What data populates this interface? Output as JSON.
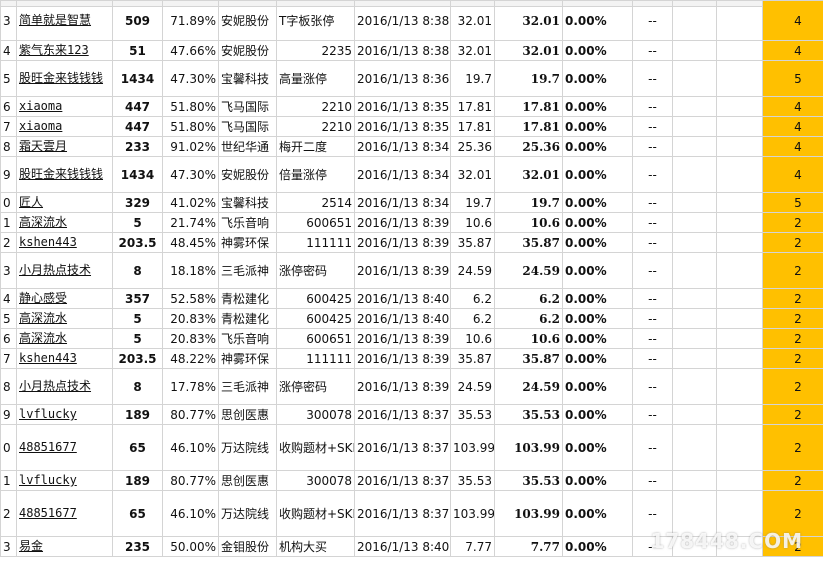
{
  "rows": [
    {
      "rn": "3",
      "user": "简单就是智慧",
      "cnt": "509",
      "pct": "71.89%",
      "stock": "安妮股份",
      "code": "T字板张停",
      "time": "2016/1/13 8:38",
      "p1": "32.01",
      "p2": "32.01",
      "chg": "0.00%",
      "dash": "--",
      "lvl": "4"
    },
    {
      "rn": "4",
      "user": "紫气东来123",
      "cnt": "51",
      "pct": "47.66%",
      "stock": "安妮股份",
      "code": "2235",
      "time": "2016/1/13 8:38",
      "p1": "32.01",
      "p2": "32.01",
      "chg": "0.00%",
      "dash": "--",
      "lvl": "4"
    },
    {
      "rn": "5",
      "user": "股旺金来钱钱钱",
      "cnt": "1434",
      "pct": "47.30%",
      "stock": "宝馨科技",
      "code": "高量涨停",
      "time": "2016/1/13 8:36",
      "p1": "19.7",
      "p2": "19.7",
      "chg": "0.00%",
      "dash": "--",
      "lvl": "5"
    },
    {
      "rn": "6",
      "user": "xiaoma",
      "cnt": "447",
      "pct": "51.80%",
      "stock": "飞马国际",
      "code": "2210",
      "time": "2016/1/13 8:35",
      "p1": "17.81",
      "p2": "17.81",
      "chg": "0.00%",
      "dash": "--",
      "lvl": "4"
    },
    {
      "rn": "7",
      "user": "xiaoma",
      "cnt": "447",
      "pct": "51.80%",
      "stock": "飞马国际",
      "code": "2210",
      "time": "2016/1/13 8:35",
      "p1": "17.81",
      "p2": "17.81",
      "chg": "0.00%",
      "dash": "--",
      "lvl": "4"
    },
    {
      "rn": "8",
      "user": "霜天雲月",
      "cnt": "233",
      "pct": "91.02%",
      "stock": "世纪华通",
      "code": "梅开二度",
      "time": "2016/1/13 8:34",
      "p1": "25.36",
      "p2": "25.36",
      "chg": "0.00%",
      "dash": "--",
      "lvl": "4"
    },
    {
      "rn": "9",
      "user": "股旺金来钱钱钱",
      "cnt": "1434",
      "pct": "47.30%",
      "stock": "安妮股份",
      "code": "倍量涨停",
      "time": "2016/1/13 8:34",
      "p1": "32.01",
      "p2": "32.01",
      "chg": "0.00%",
      "dash": "--",
      "lvl": "4"
    },
    {
      "rn": "0",
      "user": "匠人",
      "cnt": "329",
      "pct": "41.02%",
      "stock": "宝馨科技",
      "code": "2514",
      "time": "2016/1/13 8:34",
      "p1": "19.7",
      "p2": "19.7",
      "chg": "0.00%",
      "dash": "--",
      "lvl": "5"
    },
    {
      "rn": "1",
      "user": "高深流水",
      "cnt": "5",
      "pct": "21.74%",
      "stock": "飞乐音响",
      "code": "600651",
      "time": "2016/1/13 8:39",
      "p1": "10.6",
      "p2": "10.6",
      "chg": "0.00%",
      "dash": "--",
      "lvl": "2"
    },
    {
      "rn": "2",
      "user": "kshen443",
      "cnt": "203.5",
      "pct": "48.45%",
      "stock": "神雾环保",
      "code": "111111",
      "time": "2016/1/13 8:39",
      "p1": "35.87",
      "p2": "35.87",
      "chg": "0.00%",
      "dash": "--",
      "lvl": "2"
    },
    {
      "rn": "3",
      "user": "小月热点技术",
      "cnt": "8",
      "pct": "18.18%",
      "stock": "三毛派神",
      "code": "涨停密码",
      "time": "2016/1/13 8:39",
      "p1": "24.59",
      "p2": "24.59",
      "chg": "0.00%",
      "dash": "--",
      "lvl": "2"
    },
    {
      "rn": "4",
      "user": "静心感受",
      "cnt": "357",
      "pct": "52.58%",
      "stock": "青松建化",
      "code": "600425",
      "time": "2016/1/13 8:40",
      "p1": "6.2",
      "p2": "6.2",
      "chg": "0.00%",
      "dash": "--",
      "lvl": "2"
    },
    {
      "rn": "5",
      "user": "高深流水",
      "cnt": "5",
      "pct": "20.83%",
      "stock": "青松建化",
      "code": "600425",
      "time": "2016/1/13 8:40",
      "p1": "6.2",
      "p2": "6.2",
      "chg": "0.00%",
      "dash": "--",
      "lvl": "2"
    },
    {
      "rn": "6",
      "user": "高深流水",
      "cnt": "5",
      "pct": "20.83%",
      "stock": "飞乐音响",
      "code": "600651",
      "time": "2016/1/13 8:39",
      "p1": "10.6",
      "p2": "10.6",
      "chg": "0.00%",
      "dash": "--",
      "lvl": "2"
    },
    {
      "rn": "7",
      "user": "kshen443",
      "cnt": "203.5",
      "pct": "48.22%",
      "stock": "神雾环保",
      "code": "111111",
      "time": "2016/1/13 8:39",
      "p1": "35.87",
      "p2": "35.87",
      "chg": "0.00%",
      "dash": "--",
      "lvl": "2"
    },
    {
      "rn": "8",
      "user": "小月热点技术",
      "cnt": "8",
      "pct": "17.78%",
      "stock": "三毛派神",
      "code": "涨停密码",
      "time": "2016/1/13 8:39",
      "p1": "24.59",
      "p2": "24.59",
      "chg": "0.00%",
      "dash": "--",
      "lvl": "2"
    },
    {
      "rn": "9",
      "user": "lvflucky",
      "cnt": "189",
      "pct": "80.77%",
      "stock": "思创医惠",
      "code": "300078",
      "time": "2016/1/13 8:37",
      "p1": "35.53",
      "p2": "35.53",
      "chg": "0.00%",
      "dash": "--",
      "lvl": "2"
    },
    {
      "rn": "0",
      "user": "48851677",
      "cnt": "65",
      "pct": "46.10%",
      "stock": "万达院线",
      "code": "收购题材+SKDJ+小阳线",
      "time": "2016/1/13 8:37",
      "p1": "103.99",
      "p2": "103.99",
      "chg": "0.00%",
      "dash": "--",
      "lvl": "2"
    },
    {
      "rn": "1",
      "user": "lvflucky",
      "cnt": "189",
      "pct": "80.77%",
      "stock": "思创医惠",
      "code": "300078",
      "time": "2016/1/13 8:37",
      "p1": "35.53",
      "p2": "35.53",
      "chg": "0.00%",
      "dash": "--",
      "lvl": "2"
    },
    {
      "rn": "2",
      "user": "48851677",
      "cnt": "65",
      "pct": "46.10%",
      "stock": "万达院线",
      "code": "收购题材+SKDJ+小阳线",
      "time": "2016/1/13 8:37",
      "p1": "103.99",
      "p2": "103.99",
      "chg": "0.00%",
      "dash": "--",
      "lvl": "2"
    },
    {
      "rn": "3",
      "user": "易金",
      "cnt": "235",
      "pct": "50.00%",
      "stock": "金钼股份",
      "code": "机构大买",
      "time": "2016/1/13 8:40",
      "p1": "7.77",
      "p2": "7.77",
      "chg": "0.00%",
      "dash": "--",
      "lvl": "2"
    }
  ],
  "watermark": "178448.COM",
  "colors": {
    "level_fill": "#ffc000",
    "link": "#1a36c8"
  }
}
